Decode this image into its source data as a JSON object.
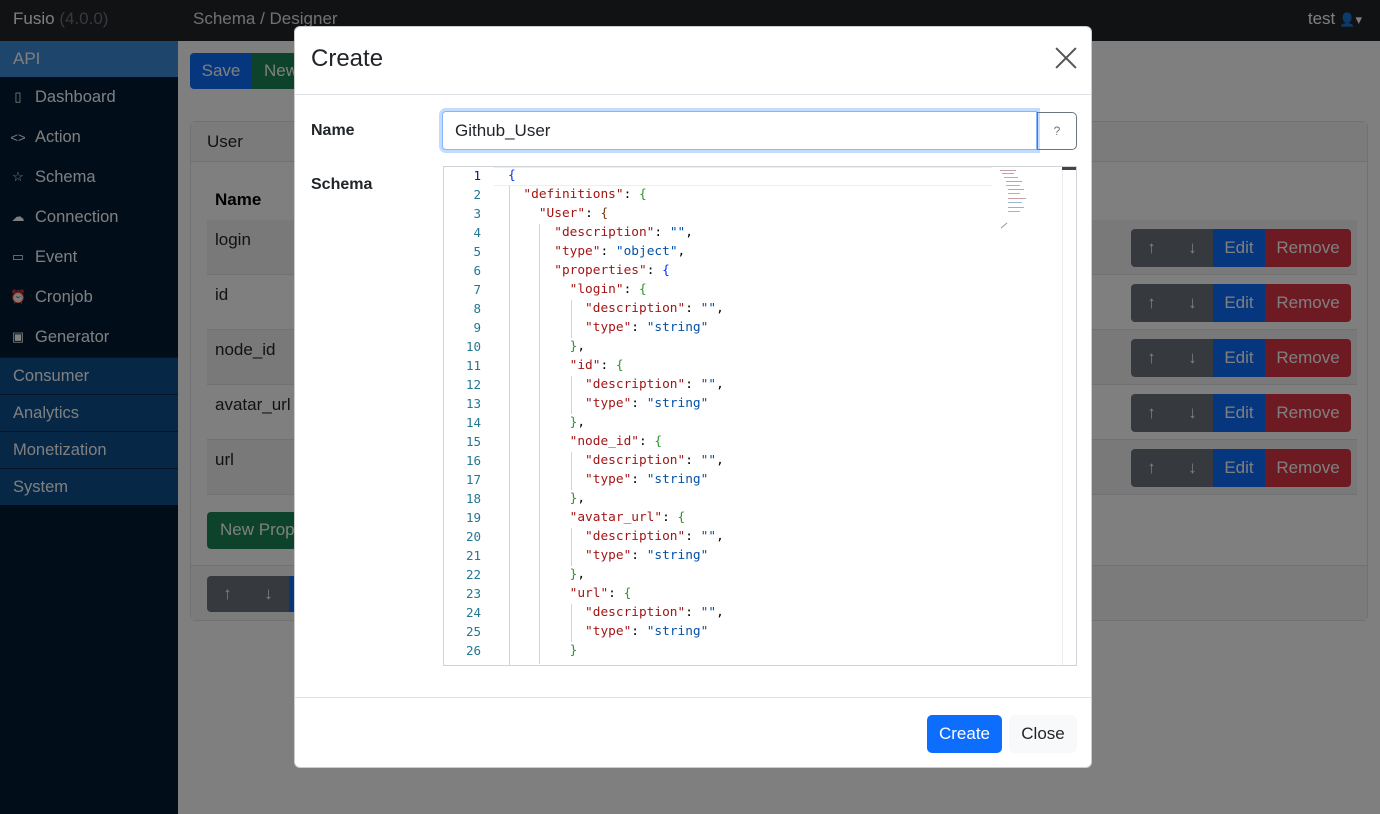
{
  "topbar": {
    "brand": "Fusio",
    "version": "(4.0.0)",
    "breadcrumb": "Schema / Designer",
    "user": "test"
  },
  "sidebar": {
    "api_label": "API",
    "items": [
      {
        "label": "Dashboard",
        "icon": "tablet-icon"
      },
      {
        "label": "Action",
        "icon": "code-icon"
      },
      {
        "label": "Schema",
        "icon": "star-icon"
      },
      {
        "label": "Connection",
        "icon": "cloud-icon"
      },
      {
        "label": "Event",
        "icon": "calendar-icon"
      },
      {
        "label": "Cronjob",
        "icon": "alarm-icon"
      },
      {
        "label": "Generator",
        "icon": "cpu-icon"
      }
    ],
    "groups": [
      "Consumer",
      "Analytics",
      "Monetization",
      "System"
    ]
  },
  "main": {
    "save_label": "Save",
    "new_label": "New",
    "card_title": "User",
    "name_header": "Name",
    "rows": [
      "login",
      "id",
      "node_id",
      "avatar_url",
      "url"
    ],
    "row_buttons": {
      "up": "↑",
      "down": "↓",
      "edit": "Edit",
      "remove": "Remove"
    },
    "new_property_label": "New Prope"
  },
  "modal": {
    "title": "Create",
    "name_label": "Name",
    "name_value": "Github_User",
    "help_label": "?",
    "schema_label": "Schema",
    "code_lines": [
      "{",
      "  \"definitions\": {",
      "    \"User\": {",
      "      \"description\": \"\",",
      "      \"type\": \"object\",",
      "      \"properties\": {",
      "        \"login\": {",
      "          \"description\": \"\",",
      "          \"type\": \"string\"",
      "        },",
      "        \"id\": {",
      "          \"description\": \"\",",
      "          \"type\": \"string\"",
      "        },",
      "        \"node_id\": {",
      "          \"description\": \"\",",
      "          \"type\": \"string\"",
      "        },",
      "        \"avatar_url\": {",
      "          \"description\": \"\",",
      "          \"type\": \"string\"",
      "        },",
      "        \"url\": {",
      "          \"description\": \"\",",
      "          \"type\": \"string\"",
      "        }"
    ],
    "create_label": "Create",
    "close_label": "Close"
  },
  "colors": {
    "primary": "#0d6efd",
    "success": "#198754",
    "danger": "#dc3545",
    "secondary": "#6c757d",
    "sidebar": "#031a33",
    "sidebar_group": "#0d4f8c",
    "topbar": "#212529"
  }
}
